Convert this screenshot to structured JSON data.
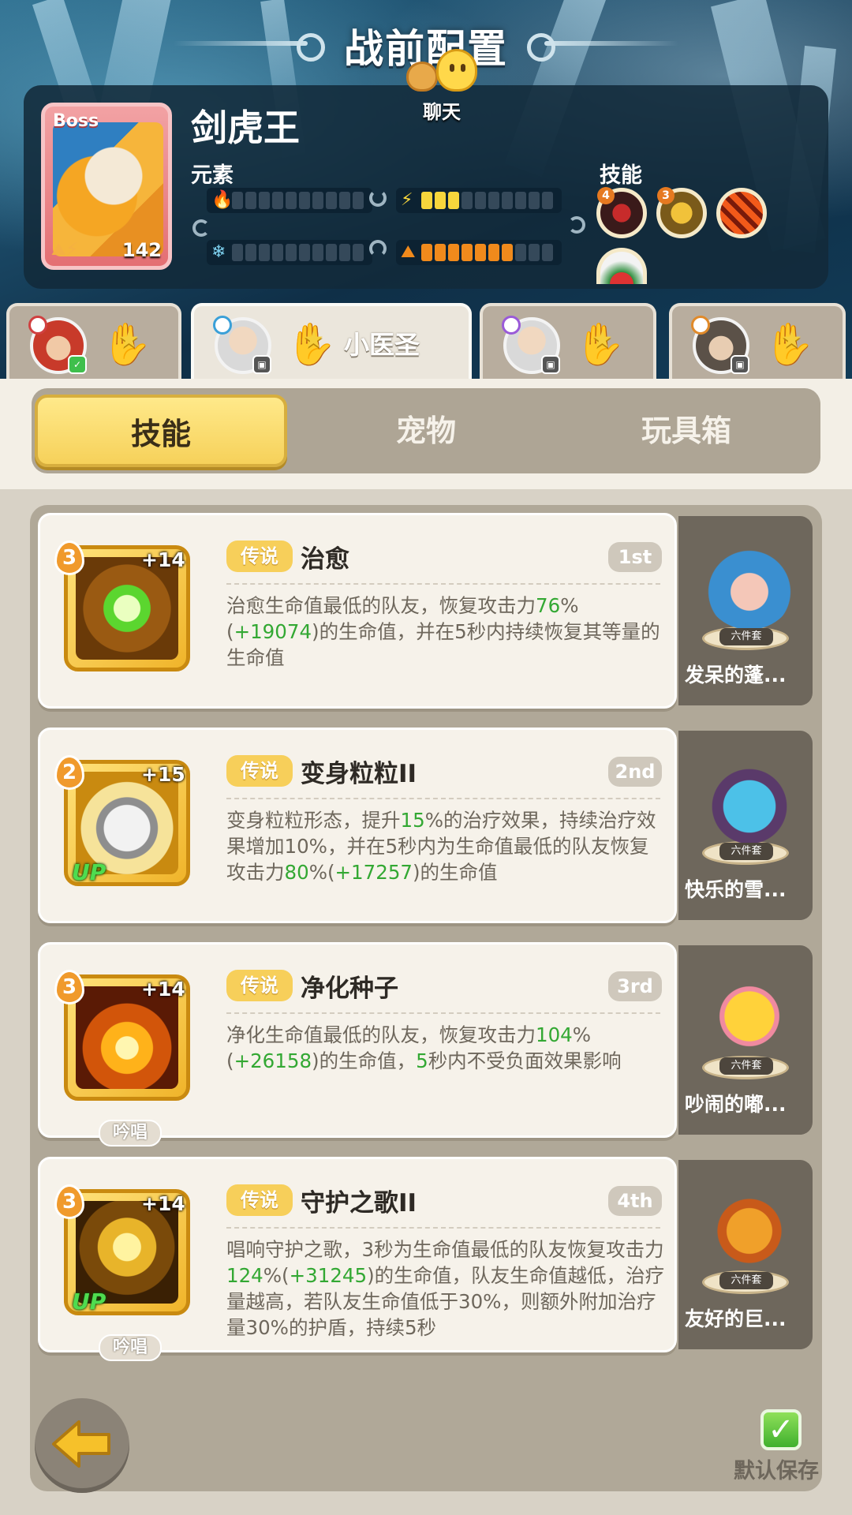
{
  "header": {
    "title": "战前配置",
    "chat_label": "聊天"
  },
  "boss": {
    "tag": "Boss",
    "name": "剑虎王",
    "level": "142",
    "element_label": "元素",
    "skill_label": "技能",
    "elements": [
      {
        "icon": "fire-icon",
        "glyph": "🔥",
        "filled": 0,
        "total": 10,
        "color": "#e84a2a"
      },
      {
        "icon": "lightning-icon",
        "glyph": "⚡",
        "filled": 3,
        "total": 10,
        "color": "#f7d63c"
      },
      {
        "icon": "snowflake-icon",
        "glyph": "❄",
        "filled": 0,
        "total": 10,
        "color": "#7fd3f2"
      },
      {
        "icon": "mountain-icon",
        "glyph": "⛰",
        "filled": 7,
        "total": 10,
        "color": "#f08a1c"
      }
    ],
    "skills": [
      {
        "level": "4"
      },
      {
        "level": "3"
      },
      {
        "level": ""
      },
      {
        "level": ""
      }
    ]
  },
  "hero_tabs": [
    {
      "name": "",
      "active": false
    },
    {
      "name": "小医圣",
      "active": true
    },
    {
      "name": "",
      "active": false
    },
    {
      "name": "",
      "active": false
    }
  ],
  "segments": [
    {
      "label": "技能",
      "active": true
    },
    {
      "label": "宠物",
      "active": false
    },
    {
      "label": "玩具箱",
      "active": false
    }
  ],
  "skills": [
    {
      "level": "3",
      "plus": "+14",
      "up": "",
      "chant": "",
      "rarity": "传说",
      "name": "治愈",
      "order": "1st",
      "desc_parts": [
        {
          "t": "治愈生命值最低的队友，恢复攻击力",
          "g": false
        },
        {
          "t": "76",
          "g": true
        },
        {
          "t": "%(",
          "g": false
        },
        {
          "t": "+19074",
          "g": true
        },
        {
          "t": ")的生命值，并在5秒内持续恢复其等量的生命值",
          "g": false
        }
      ],
      "pet": {
        "name": "发呆的蓬...",
        "set": "六件套"
      }
    },
    {
      "level": "2",
      "plus": "+15",
      "up": "UP",
      "chant": "",
      "rarity": "传说",
      "name": "变身粒粒II",
      "order": "2nd",
      "desc_parts": [
        {
          "t": "变身粒粒形态，提升",
          "g": false
        },
        {
          "t": "15",
          "g": true
        },
        {
          "t": "%的治疗效果，持续治疗效果增加10%，并在5秒内为生命值最低的队友恢复攻击力",
          "g": false
        },
        {
          "t": "80",
          "g": true
        },
        {
          "t": "%(",
          "g": false
        },
        {
          "t": "+17257",
          "g": true
        },
        {
          "t": ")的生命值",
          "g": false
        }
      ],
      "pet": {
        "name": "快乐的雪...",
        "set": "六件套"
      }
    },
    {
      "level": "3",
      "plus": "+14",
      "up": "",
      "chant": "吟唱",
      "rarity": "传说",
      "name": "净化种子",
      "order": "3rd",
      "desc_parts": [
        {
          "t": "净化生命值最低的队友，恢复攻击力",
          "g": false
        },
        {
          "t": "104",
          "g": true
        },
        {
          "t": "%(",
          "g": false
        },
        {
          "t": "+26158",
          "g": true
        },
        {
          "t": ")的生命值，",
          "g": false
        },
        {
          "t": "5",
          "g": true
        },
        {
          "t": "秒内不受负面效果影响",
          "g": false
        }
      ],
      "pet": {
        "name": "吵闹的嘟...",
        "set": "六件套"
      }
    },
    {
      "level": "3",
      "plus": "+14",
      "up": "UP",
      "chant": "吟唱",
      "rarity": "传说",
      "name": "守护之歌II",
      "order": "4th",
      "desc_parts": [
        {
          "t": "唱响守护之歌，3秒为生命值最低的队友恢复攻击力",
          "g": false
        },
        {
          "t": "124",
          "g": true
        },
        {
          "t": "%(",
          "g": false
        },
        {
          "t": "+31245",
          "g": true
        },
        {
          "t": ")的生命值，队友生命值越低，治疗量越高，若队友生命值低于30%，则额外附加治疗量30%的护盾，持续5秒",
          "g": false
        }
      ],
      "pet": {
        "name": "友好的巨...",
        "set": "六件套"
      }
    }
  ],
  "footer": {
    "save_label": "默认保存"
  },
  "colors": {
    "accent_yellow": "#f6d15a",
    "heal_green": "#33a833",
    "rarity_gold": "#f7cf5a"
  }
}
